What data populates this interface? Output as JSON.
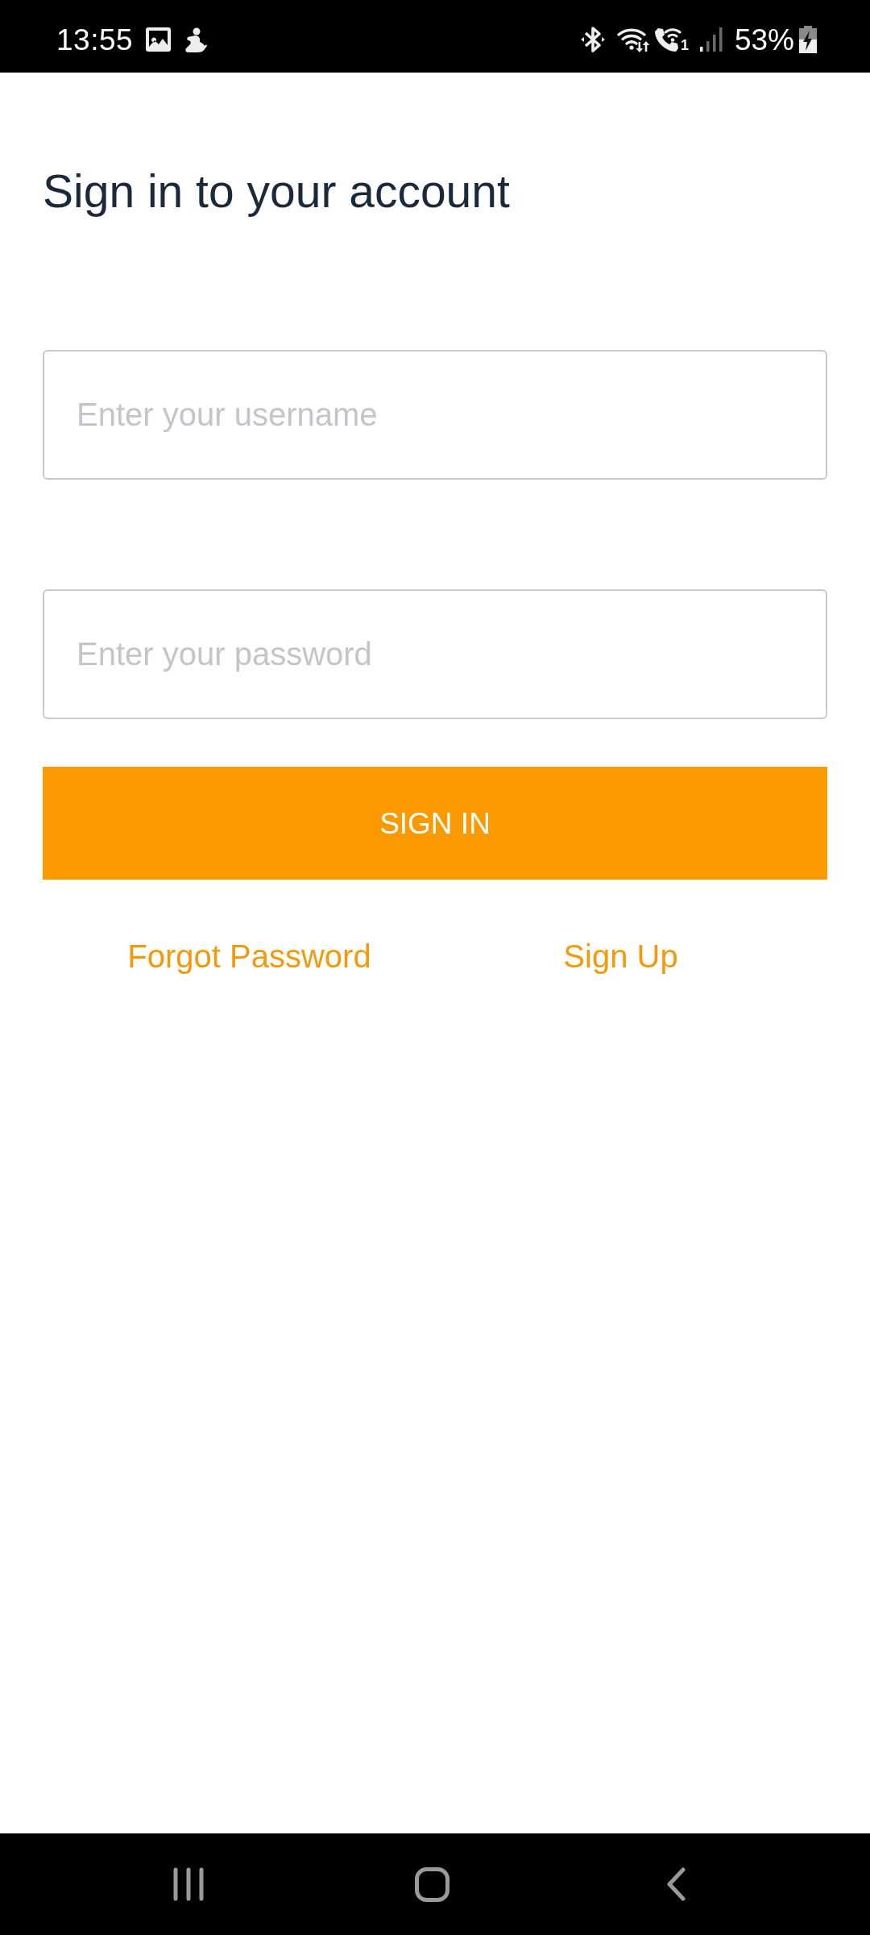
{
  "status_bar": {
    "time": "13:55",
    "call_sim": "1",
    "battery": "53%"
  },
  "title": "Sign in to your account",
  "fields": [
    {
      "placeholder": "Enter your username"
    },
    {
      "placeholder": "Enter your password"
    }
  ],
  "sign_in_button": {
    "label": "SIGN IN"
  },
  "links": [
    {
      "label": "Forgot Password"
    },
    {
      "label": "Sign Up"
    }
  ]
}
